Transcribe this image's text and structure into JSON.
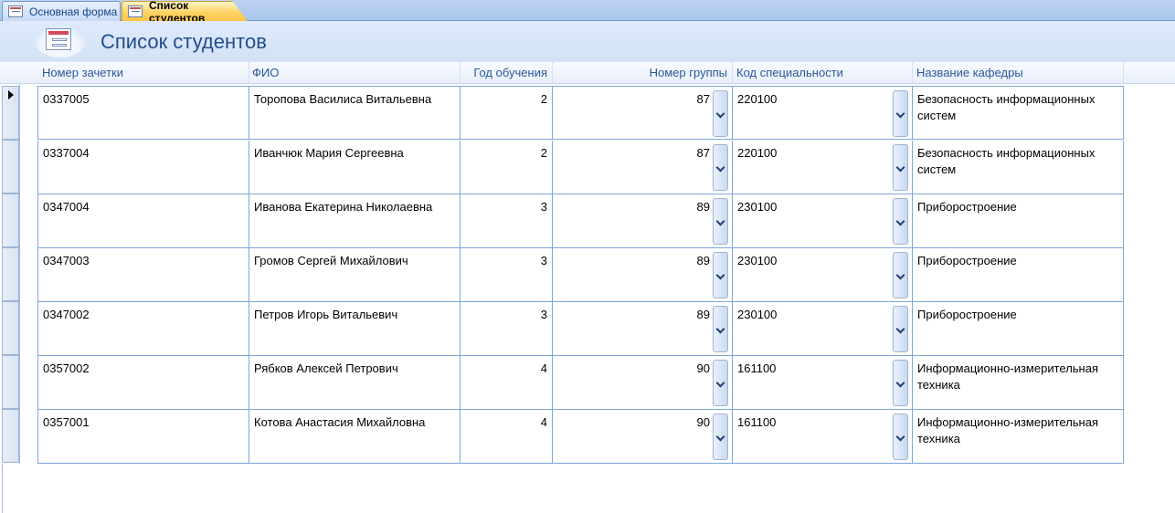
{
  "tabs": [
    {
      "label": "Основная форма",
      "active": false
    },
    {
      "label": "Список студентов",
      "active": true
    }
  ],
  "form": {
    "title": "Список студентов"
  },
  "columns": [
    "Номер зачетки",
    "ФИО",
    "Год обучения",
    "Номер группы",
    "Код специальности",
    "Название кафедры"
  ],
  "current_record_index": 0,
  "rows": [
    {
      "record_no": "0337005",
      "name": "Торопова Василиса Витальевна",
      "year": "2",
      "group": "87",
      "specialty_code": "220100",
      "department": "Безопасность информационных систем"
    },
    {
      "record_no": "0337004",
      "name": "Иванчюк Мария Сергеевна",
      "year": "2",
      "group": "87",
      "specialty_code": "220100",
      "department": "Безопасность информационных систем"
    },
    {
      "record_no": "0347004",
      "name": "Иванова Екатерина Николаевна",
      "year": "3",
      "group": "89",
      "specialty_code": "230100",
      "department": "Приборостроение"
    },
    {
      "record_no": "0347003",
      "name": "Громов Сергей Михайлович",
      "year": "3",
      "group": "89",
      "specialty_code": "230100",
      "department": "Приборостроение"
    },
    {
      "record_no": "0347002",
      "name": "Петров Игорь Витальевич",
      "year": "3",
      "group": "89",
      "specialty_code": "230100",
      "department": "Приборостроение"
    },
    {
      "record_no": "0357002",
      "name": "Рябков Алексей Петрович",
      "year": "4",
      "group": "90",
      "specialty_code": "161100",
      "department": "Информационно-измерительная техника"
    },
    {
      "record_no": "0357001",
      "name": "Котова Анастасия Михайловна",
      "year": "4",
      "group": "90",
      "specialty_code": "161100",
      "department": "Информационно-измерительная техника"
    }
  ],
  "colors": {
    "header_text": "#1f4e8c",
    "column_header_text": "#2b5797",
    "grid_border": "#7ea6db",
    "active_tab": "#ffd466"
  }
}
